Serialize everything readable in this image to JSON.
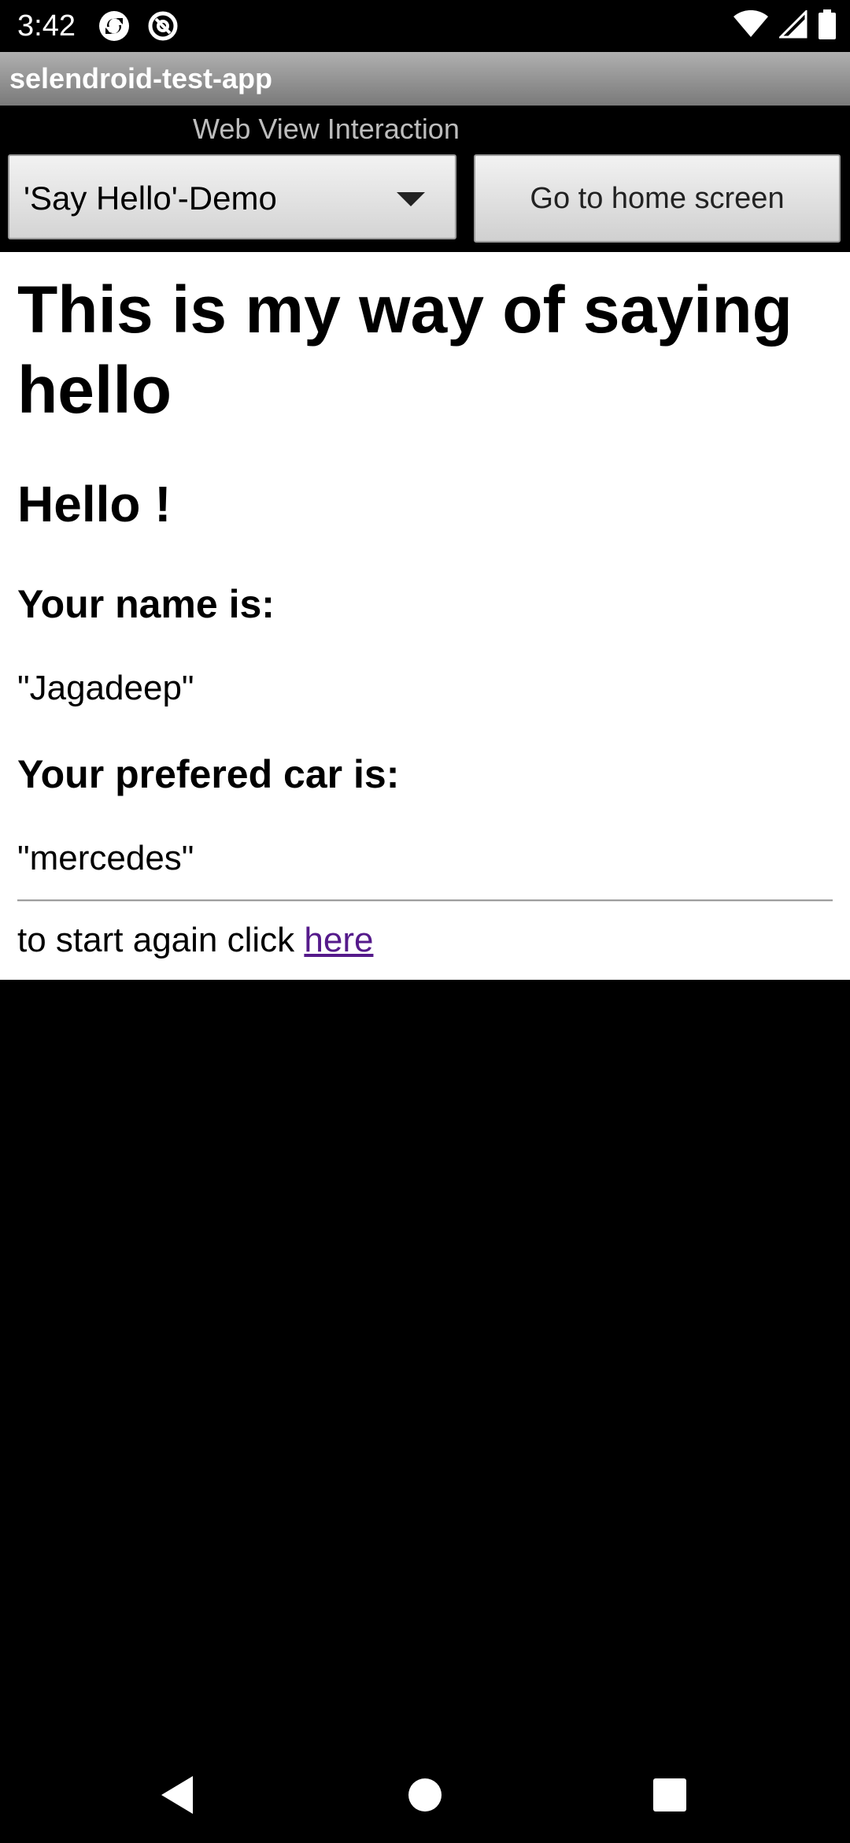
{
  "status_bar": {
    "time": "3:42",
    "left_icons": [
      "sync-circle-icon",
      "at-sign-icon"
    ],
    "right_icons": [
      "wifi-icon",
      "cell-signal-icon",
      "battery-icon"
    ]
  },
  "app": {
    "title": "selendroid-test-app"
  },
  "activity": {
    "label": "Web View Interaction",
    "spinner_selected": "'Say Hello'-Demo",
    "home_button_label": "Go to home screen"
  },
  "webview": {
    "heading": "This is my way of saying hello",
    "greeting": "Hello !",
    "name_label": "Your name is:",
    "name_value": "\"Jagadeep\"",
    "car_label": "Your prefered car is:",
    "car_value": "\"mercedes\"",
    "restart_text": "to start again click ",
    "restart_link": "here"
  },
  "nav_bar": {
    "buttons": [
      "back-icon",
      "home-icon",
      "recents-icon"
    ]
  },
  "colors": {
    "link": "#551a8b",
    "title_bar": "#8f8f8f",
    "activity_label": "#bdbdbd"
  }
}
